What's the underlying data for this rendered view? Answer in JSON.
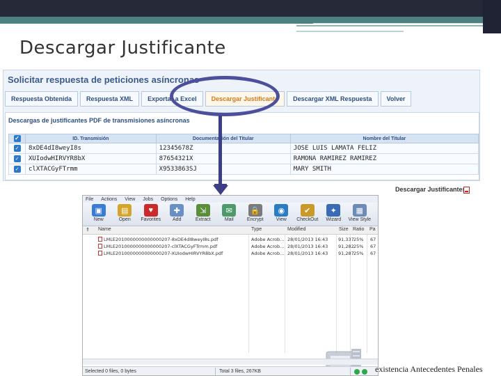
{
  "slide": {
    "title": "Descargar Justificante",
    "footer": "existencia Antecedentes Penales"
  },
  "web_app": {
    "section_title": "Solicitar respuesta de peticiones asíncronas",
    "tabs": [
      {
        "label": "Respuesta Obtenida",
        "active": false
      },
      {
        "label": "Respuesta XML",
        "active": false
      },
      {
        "label": "Exportar a Excel",
        "active": false
      },
      {
        "label": "Descargar Justificante",
        "active": true
      },
      {
        "label": "Descargar XML Respuesta",
        "active": false
      },
      {
        "label": "Volver",
        "active": false
      }
    ],
    "subsection_title": "Descargas de justificantes PDF de transmisiones asíncronas",
    "table": {
      "headers": [
        "ID. Transmisión",
        "Documentación del Titular",
        "Nombre del Titular"
      ],
      "rows": [
        {
          "id": "8xDE4dI8weyI8s",
          "doc": "12345678Z",
          "name": "JOSE LUIS LAMATA FELIZ"
        },
        {
          "id": "XUIodwHIRVYR8bX",
          "doc": "87654321X",
          "name": "RAMONA RAMIREZ RAMIREZ"
        },
        {
          "id": "clXTACGyFTrmm",
          "doc": "X9533863SJ",
          "name": "MARY SMITH"
        }
      ]
    },
    "download_link": "Descargar Justificantes"
  },
  "winzip": {
    "menu": [
      "File",
      "Actions",
      "View",
      "Jobs",
      "Options",
      "Help"
    ],
    "toolbar": [
      {
        "label": "New",
        "icon": "new-archive-icon",
        "color": "#3a7bd5"
      },
      {
        "label": "Open",
        "icon": "open-folder-icon",
        "color": "#d4a52a"
      },
      {
        "label": "Favorites",
        "icon": "favorites-heart-icon",
        "color": "#cc2a2a"
      },
      {
        "label": "Add",
        "icon": "add-files-icon",
        "color": "#6a8fc4"
      },
      {
        "label": "Extract",
        "icon": "extract-icon",
        "color": "#5b8d3a"
      },
      {
        "label": "Mail",
        "icon": "mail-icon",
        "color": "#4f9a6b"
      },
      {
        "label": "Encrypt",
        "icon": "encrypt-lock-icon",
        "color": "#7b7b7b"
      },
      {
        "label": "View",
        "icon": "view-eye-icon",
        "color": "#2b7cc2"
      },
      {
        "label": "CheckOut",
        "icon": "checkout-icon",
        "color": "#c99a2a"
      },
      {
        "label": "Wizard",
        "icon": "wizard-icon",
        "color": "#3b6bb5"
      },
      {
        "label": "View Style",
        "icon": "view-style-icon",
        "color": "#6d8bb8"
      }
    ],
    "columns": [
      "Name",
      "Type",
      "Modified",
      "Size",
      "Ratio",
      "Pa"
    ],
    "files": [
      {
        "name": "LMLE2010000000000000207-8xDE4dI8weyI8s.pdf",
        "type": "Adobe Acrob...",
        "modified": "28/01/2013 16:43",
        "size": "91,337",
        "ratio": "25%",
        "packed": "67"
      },
      {
        "name": "LMLE2010000000000000207-clXTACGyFTrmm.pdf",
        "type": "Adobe Acrob...",
        "modified": "28/01/2013 16:43",
        "size": "91,282",
        "ratio": "25%",
        "packed": "67"
      },
      {
        "name": "LMLE2010000000000000207-XUIodwHIRVYR8bX.pdf",
        "type": "Adobe Acrob...",
        "modified": "28/01/2013 16:43",
        "size": "91,287",
        "ratio": "25%",
        "packed": "67"
      }
    ],
    "status_left": "Selected 0 files, 0 bytes",
    "status_mid": "Total 3 files, 267KB"
  }
}
